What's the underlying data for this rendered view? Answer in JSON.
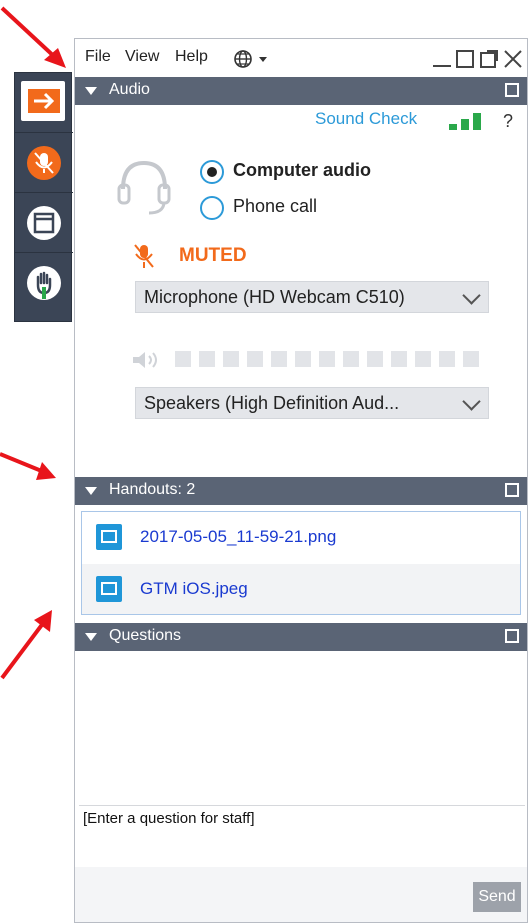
{
  "menu": {
    "file": "File",
    "view": "View",
    "help": "Help"
  },
  "audio": {
    "header": "Audio",
    "sound_check": "Sound Check",
    "help_mark": "?",
    "option_computer": "Computer audio",
    "option_phone": "Phone call",
    "muted_label": "MUTED",
    "microphone": "Microphone (HD Webcam C510)",
    "speakers": "Speakers (High  Definition  Aud..."
  },
  "handouts": {
    "header": "Handouts: 2",
    "files": [
      "2017-05-05_11-59-21.png",
      "GTM iOS.jpeg"
    ]
  },
  "questions": {
    "header": "Questions",
    "placeholder": "[Enter a question for staff]",
    "send": "Send"
  },
  "colors": {
    "accent_orange": "#f26a1b",
    "header_gray": "#5a6475",
    "link_blue": "#1a3ad0",
    "sound_green": "#2aa84a",
    "toolbar": "#3b4556"
  }
}
